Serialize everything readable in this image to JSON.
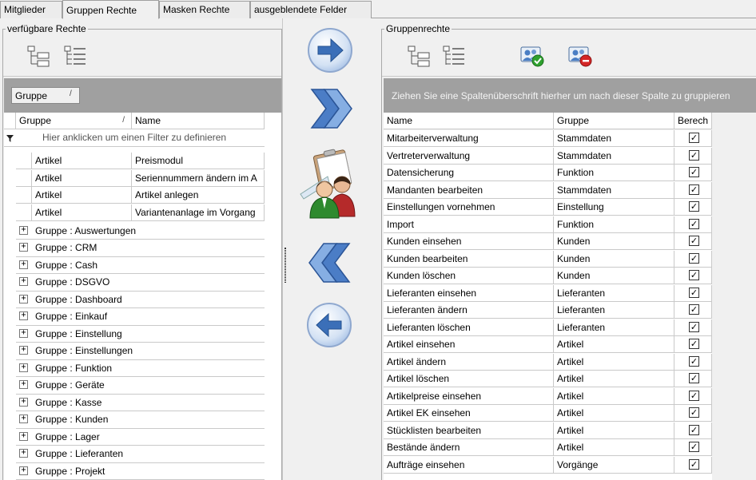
{
  "tabs": [
    "Mitglieder",
    "Gruppen Rechte",
    "Masken Rechte",
    "ausgeblendete Felder"
  ],
  "active_tab": "Gruppen Rechte",
  "left": {
    "title": "verfügbare Rechte",
    "group_chip": "Gruppe",
    "chip_sort": "/",
    "columns": [
      "Gruppe",
      "Name"
    ],
    "col_sort": "/",
    "filter_placeholder": "Hier anklicken um einen Filter zu definieren",
    "rows": [
      {
        "gruppe": "Artikel",
        "name": "Preismodul"
      },
      {
        "gruppe": "Artikel",
        "name": "Seriennummern ändern im A"
      },
      {
        "gruppe": "Artikel",
        "name": "Artikel anlegen"
      },
      {
        "gruppe": "Artikel",
        "name": "Variantenanlage im Vorgang"
      }
    ],
    "groups": [
      "Gruppe : Auswertungen",
      "Gruppe : CRM",
      "Gruppe : Cash",
      "Gruppe : DSGVO",
      "Gruppe : Dashboard",
      "Gruppe : Einkauf",
      "Gruppe : Einstellung",
      "Gruppe : Einstellungen",
      "Gruppe : Funktion",
      "Gruppe : Geräte",
      "Gruppe : Kasse",
      "Gruppe : Kunden",
      "Gruppe : Lager",
      "Gruppe : Lieferanten",
      "Gruppe : Projekt"
    ]
  },
  "right": {
    "title": "Gruppenrechte",
    "group_hint": "Ziehen Sie eine Spaltenüberschrift hierher um nach dieser Spalte zu gruppieren",
    "columns": [
      "Name",
      "Gruppe",
      "Berech"
    ],
    "rows": [
      {
        "name": "Mitarbeiterverwaltung",
        "gruppe": "Stammdaten",
        "checked": true
      },
      {
        "name": "Vertreterverwaltung",
        "gruppe": "Stammdaten",
        "checked": true
      },
      {
        "name": "Datensicherung",
        "gruppe": "Funktion",
        "checked": true
      },
      {
        "name": "Mandanten bearbeiten",
        "gruppe": "Stammdaten",
        "checked": true
      },
      {
        "name": "Einstellungen vornehmen",
        "gruppe": "Einstellung",
        "checked": true
      },
      {
        "name": "Import",
        "gruppe": "Funktion",
        "checked": true
      },
      {
        "name": "Kunden einsehen",
        "gruppe": "Kunden",
        "checked": true
      },
      {
        "name": "Kunden bearbeiten",
        "gruppe": "Kunden",
        "checked": true
      },
      {
        "name": "Kunden löschen",
        "gruppe": "Kunden",
        "checked": true
      },
      {
        "name": "Lieferanten einsehen",
        "gruppe": "Lieferanten",
        "checked": true
      },
      {
        "name": "Lieferanten ändern",
        "gruppe": "Lieferanten",
        "checked": true
      },
      {
        "name": "Lieferanten löschen",
        "gruppe": "Lieferanten",
        "checked": true
      },
      {
        "name": "Artikel einsehen",
        "gruppe": "Artikel",
        "checked": true
      },
      {
        "name": "Artikel ändern",
        "gruppe": "Artikel",
        "checked": true
      },
      {
        "name": "Artikel löschen",
        "gruppe": "Artikel",
        "checked": true
      },
      {
        "name": "Artikelpreise einsehen",
        "gruppe": "Artikel",
        "checked": true
      },
      {
        "name": "Artikel EK einsehen",
        "gruppe": "Artikel",
        "checked": true
      },
      {
        "name": "Stücklisten bearbeiten",
        "gruppe": "Artikel",
        "checked": true
      },
      {
        "name": "Bestände ändern",
        "gruppe": "Artikel",
        "checked": true
      },
      {
        "name": "Aufträge einsehen",
        "gruppe": "Vorgänge",
        "checked": true
      }
    ]
  },
  "icons": {
    "expand_all": "expand-tree-icon",
    "collapse_all": "collapse-tree-icon",
    "grant_all": "user-grant-icon",
    "revoke_all": "user-revoke-icon",
    "add_one": "arrow-right-icon",
    "add_all": "double-chevron-right-icon",
    "manage_groups": "user-group-icon",
    "remove_all": "double-chevron-left-icon",
    "remove_one": "arrow-left-icon"
  },
  "colors": {
    "group_panel": "#a0a0a0",
    "button_blue": "#3b7bc8",
    "check_mark": "#000000"
  }
}
